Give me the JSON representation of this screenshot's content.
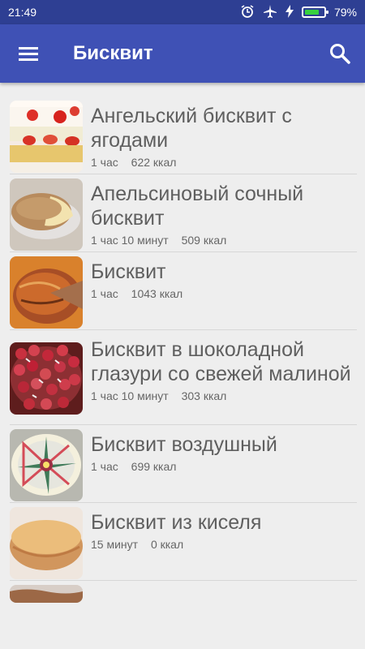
{
  "status": {
    "time": "21:49",
    "battery": "79%",
    "battery_level": 0.79
  },
  "toolbar": {
    "title": "Бисквит"
  },
  "recipes": [
    {
      "name": "Ангельский бисквит с ягодами",
      "time": "1 час",
      "calories": "622 ккал"
    },
    {
      "name": "Апельсиновый сочный бисквит",
      "time": "1 час 10 минут",
      "calories": "509 ккал"
    },
    {
      "name": "Бисквит",
      "time": "1 час",
      "calories": "1043 ккал"
    },
    {
      "name": "Бисквит в шоколадной глазури со свежей малиной",
      "time": "1 час 10 минут",
      "calories": "303 ккал"
    },
    {
      "name": "Бисквит воздушный",
      "time": "1 час",
      "calories": "699 ккал"
    },
    {
      "name": "Бисквит из киселя",
      "time": "15 минут",
      "calories": "0 ккал"
    }
  ]
}
